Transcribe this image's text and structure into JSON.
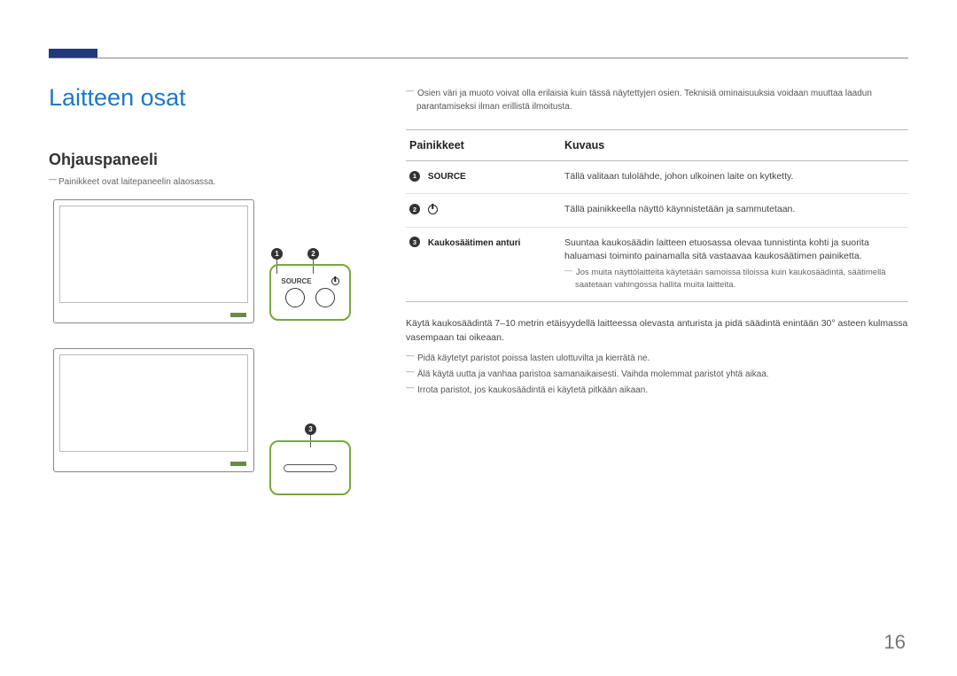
{
  "page": {
    "title": "Laitteen osat",
    "subtitle": "Ohjauspaneeli",
    "subnote": "Painikkeet ovat laitepaneelin alaosassa.",
    "number": "16"
  },
  "top_note": "Osien väri ja muoto voivat olla erilaisia kuin tässä näytettyjen osien. Teknisiä ominaisuuksia voidaan muuttaa laadun parantamiseksi ilman erillistä ilmoitusta.",
  "table": {
    "headers": {
      "col1": "Painikkeet",
      "col2": "Kuvaus"
    },
    "rows": [
      {
        "num": "1",
        "label": "SOURCE",
        "desc": "Tällä valitaan tulolähde, johon ulkoinen laite on kytketty."
      },
      {
        "num": "2",
        "label_icon": "power-icon",
        "desc": "Tällä painikkeella näyttö käynnistetään ja sammutetaan."
      },
      {
        "num": "3",
        "label": "Kaukosäätimen anturi",
        "desc": "Suuntaa kaukosäädin laitteen etuosassa olevaa tunnistinta kohti ja suorita haluamasi toiminto painamalla sitä vastaavaa kaukosäätimen painiketta.",
        "note": "Jos muita näyttölaitteita käytetään samoissa tiloissa kuin kaukosäädintä, säätimellä saatetaan vahingossa hallita muita laitteita."
      }
    ]
  },
  "below": {
    "line1": "Käytä kaukosäädintä 7–10 metrin etäisyydellä laitteessa olevasta anturista ja pidä säädintä enintään 30° asteen kulmassa vasempaan tai oikeaan.",
    "dash1": "Pidä käytetyt paristot poissa lasten ulottuvilta ja kierrätä ne.",
    "dash2": "Älä käytä uutta ja vanhaa paristoa samanaikaisesti. Vaihda molemmat paristot yhtä aikaa.",
    "dash3": "Irrota paristot, jos kaukosäädintä ei käytetä pitkään aikaan."
  },
  "diagram": {
    "source_label": "SOURCE",
    "callouts": [
      "1",
      "2",
      "3"
    ]
  }
}
